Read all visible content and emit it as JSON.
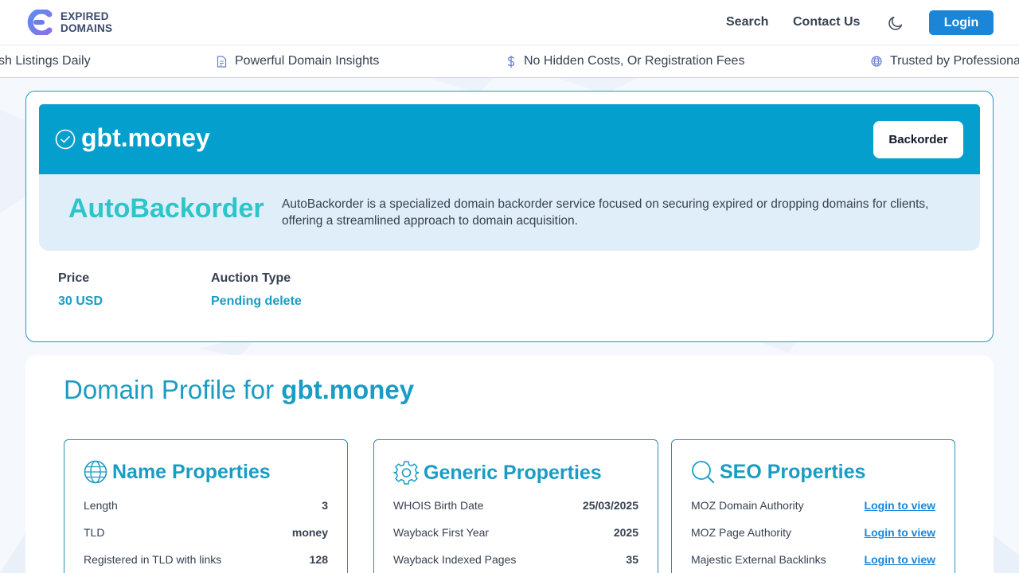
{
  "header": {
    "logo_line1": "EXPIRED",
    "logo_line2": "DOMAINS",
    "nav": {
      "search": "Search",
      "contact": "Contact Us"
    },
    "login": "Login"
  },
  "ticker": [
    {
      "label": "sh Listings Daily",
      "icon": ""
    },
    {
      "label": "Powerful Domain Insights",
      "icon": "document-icon"
    },
    {
      "label": "No Hidden Costs, Or Registration Fees",
      "icon": "dollar-icon"
    },
    {
      "label": "Trusted by Professionals",
      "icon": "globe-icon"
    }
  ],
  "domain": {
    "name": "gbt.money",
    "backorder_button": "Backorder",
    "provider": {
      "name": "AutoBackorder",
      "description": "AutoBackorder is a specialized domain backorder service focused on securing expired or dropping domains for clients, offering a streamlined approach to domain acquisition."
    },
    "price_label": "Price",
    "price_value": "30 USD",
    "auction_label": "Auction Type",
    "auction_value": "Pending delete"
  },
  "profile": {
    "title_prefix": "Domain Profile for",
    "title_domain": "gbt.money",
    "name_properties": {
      "title": "Name Properties",
      "rows": [
        {
          "label": "Length",
          "value": "3"
        },
        {
          "label": "TLD",
          "value": "money"
        },
        {
          "label": "Registered in TLD with links",
          "value": "128"
        }
      ]
    },
    "generic_properties": {
      "title": "Generic Properties",
      "rows": [
        {
          "label": "WHOIS Birth Date",
          "value": "25/03/2025"
        },
        {
          "label": "Wayback First Year",
          "value": "2025"
        },
        {
          "label": "Wayback Indexed Pages",
          "value": "35"
        }
      ]
    },
    "seo_properties": {
      "title": "SEO Properties",
      "rows": [
        {
          "label": "MOZ Domain Authority",
          "value": "Login to view"
        },
        {
          "label": "MOZ Page Authority",
          "value": "Login to view"
        },
        {
          "label": "Majestic External Backlinks",
          "value": "Login to view"
        }
      ]
    }
  },
  "colors": {
    "brand": "#1a9cc4",
    "banner": "#059fce",
    "login_button": "#1a86d9",
    "provider_text": "#2cc5c9",
    "provider_box": "#e0eef9"
  }
}
